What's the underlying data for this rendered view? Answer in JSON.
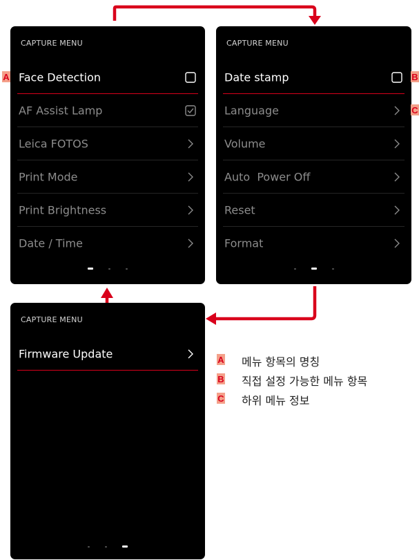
{
  "colors": {
    "accent": "#d9001b",
    "marker_bg": "#f4a08a",
    "screen_bg": "#000000"
  },
  "screens": [
    {
      "title": "CAPTURE MENU",
      "items": [
        {
          "label": "Face Detection",
          "icon": "checkbox-empty-icon"
        },
        {
          "label": "AF Assist Lamp",
          "icon": "checkbox-checked-icon"
        },
        {
          "label": "Leica FOTOS",
          "icon": "chevron-right-icon"
        },
        {
          "label": "Print Mode",
          "icon": "chevron-right-icon"
        },
        {
          "label": "Print Brightness",
          "icon": "chevron-right-icon"
        },
        {
          "label": "Date / Time",
          "icon": "chevron-right-icon"
        }
      ],
      "page_indicator": {
        "current": 1,
        "total": 3
      }
    },
    {
      "title": "CAPTURE MENU",
      "items": [
        {
          "label": "Date stamp",
          "icon": "checkbox-empty-icon"
        },
        {
          "label": "Language",
          "icon": "chevron-right-icon"
        },
        {
          "label": "Volume",
          "icon": "chevron-right-icon"
        },
        {
          "label": "Auto  Power Off",
          "icon": "chevron-right-icon"
        },
        {
          "label": "Reset",
          "icon": "chevron-right-icon"
        },
        {
          "label": "Format",
          "icon": "chevron-right-icon"
        }
      ],
      "page_indicator": {
        "current": 2,
        "total": 3
      }
    },
    {
      "title": "CAPTURE MENU",
      "items": [
        {
          "label": "Firmware Update",
          "icon": "chevron-right-icon"
        }
      ],
      "page_indicator": {
        "current": 3,
        "total": 3
      }
    }
  ],
  "markers": {
    "a": "A",
    "b": "B",
    "c": "C"
  },
  "legend": [
    {
      "marker": "A",
      "text": "메뉴 항목의 명칭"
    },
    {
      "marker": "B",
      "text": "직접 설정 가능한 메뉴 항목"
    },
    {
      "marker": "C",
      "text": "하위 메뉴 정보"
    }
  ]
}
